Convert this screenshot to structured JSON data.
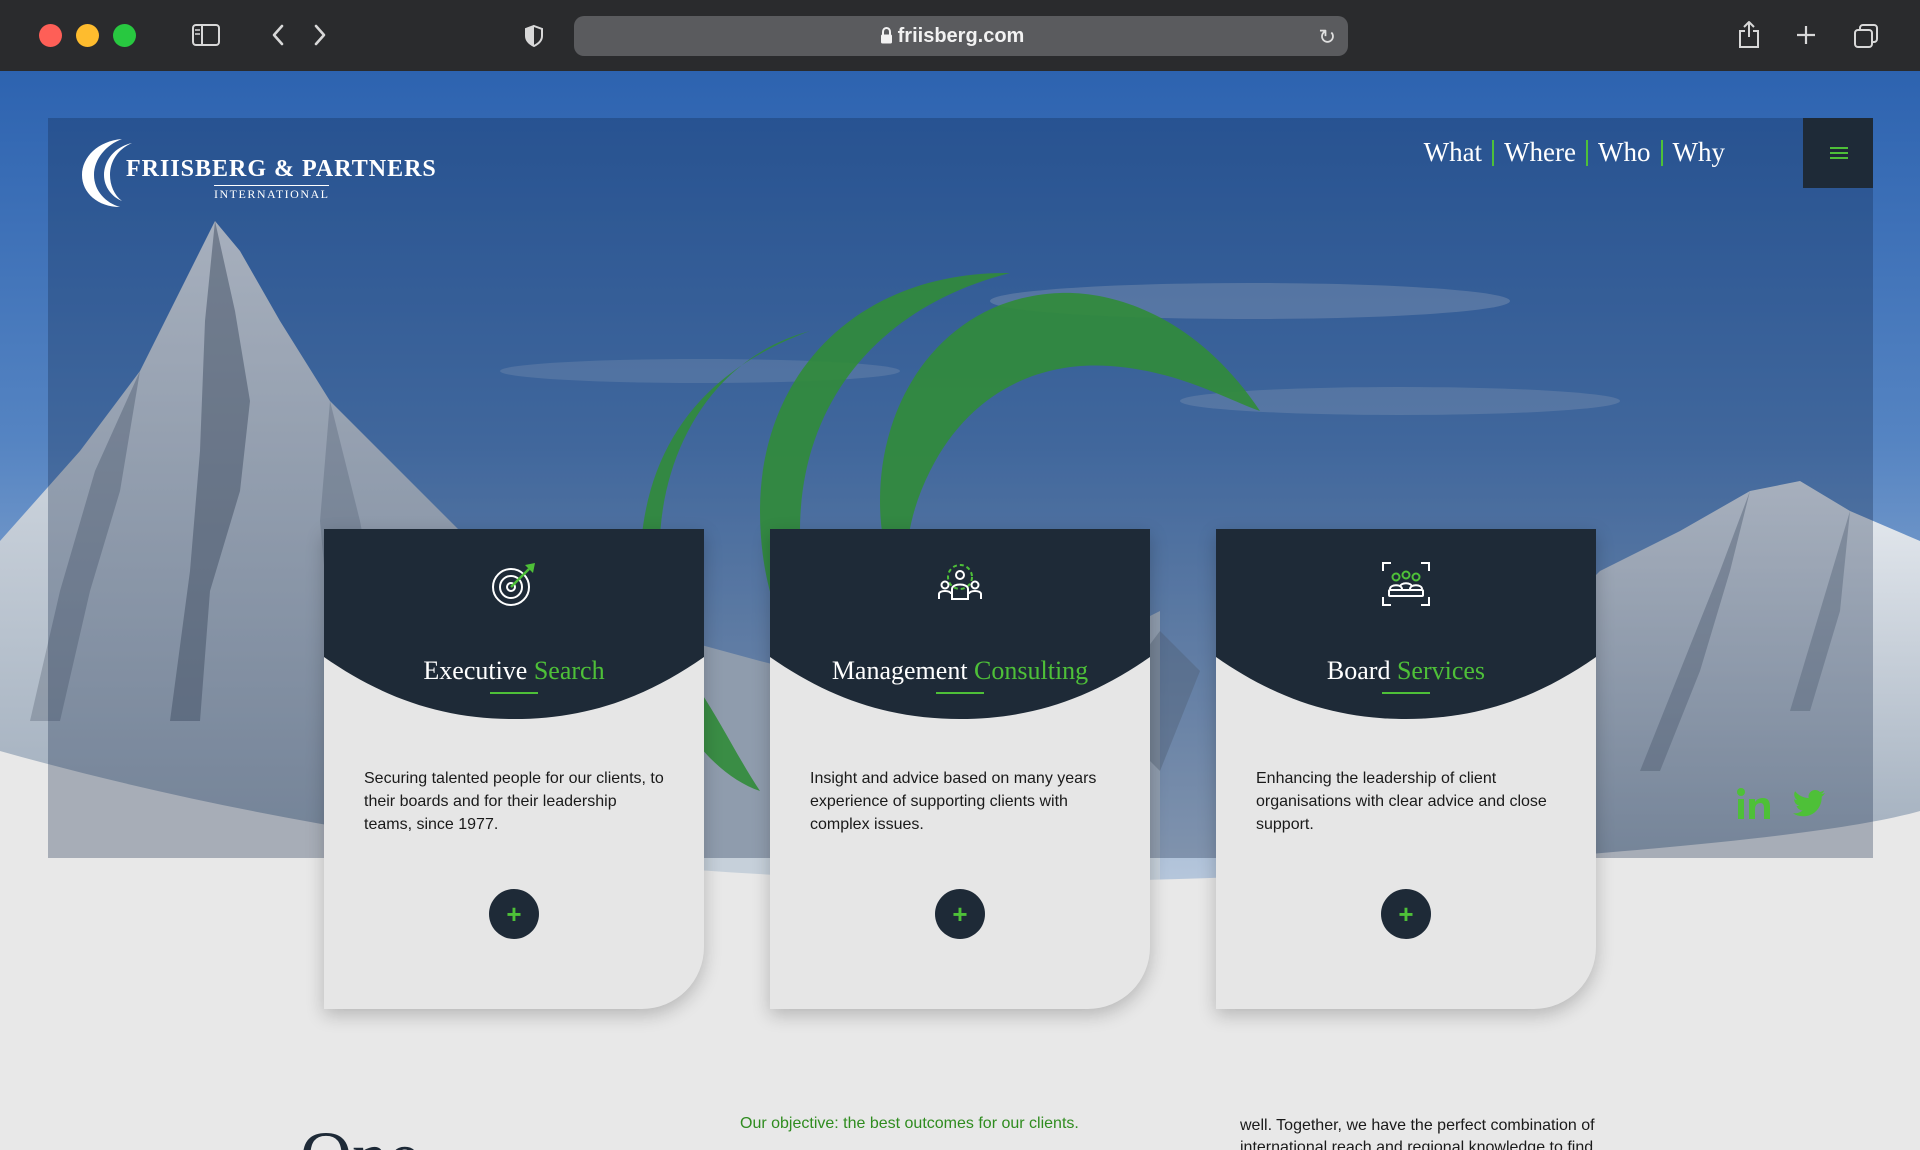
{
  "browser": {
    "url": "friisberg.com"
  },
  "header": {
    "logo_name": "FRIISBERG & PARTNERS",
    "logo_sub": "INTERNATIONAL",
    "nav": [
      "What",
      "Where",
      "Who",
      "Why"
    ]
  },
  "cards": [
    {
      "title_main": "Executive",
      "title_accent": "Search",
      "description": "Securing talented people for our clients, to their boards and for their leadership teams, since 1977.",
      "icon": "target-icon"
    },
    {
      "title_main": "Management",
      "title_accent": "Consulting",
      "description": "Insight and advice based on many years experience of supporting clients with complex issues.",
      "icon": "team-gear-icon"
    },
    {
      "title_main": "Board",
      "title_accent": "Services",
      "description": "Enhancing the leadership of client organisations with clear advice and close support.",
      "icon": "boardroom-icon"
    }
  ],
  "plus_label": "+",
  "bottom": {
    "big_heading": "One",
    "objective": "Our objective: the best outcomes for our clients.",
    "right_text": "well. Together, we have the perfect combination of international reach and regional knowledge to find"
  },
  "colors": {
    "accent_green": "#4ec038",
    "navy": "#1e2a37",
    "card_bg": "#e6e6e6"
  }
}
